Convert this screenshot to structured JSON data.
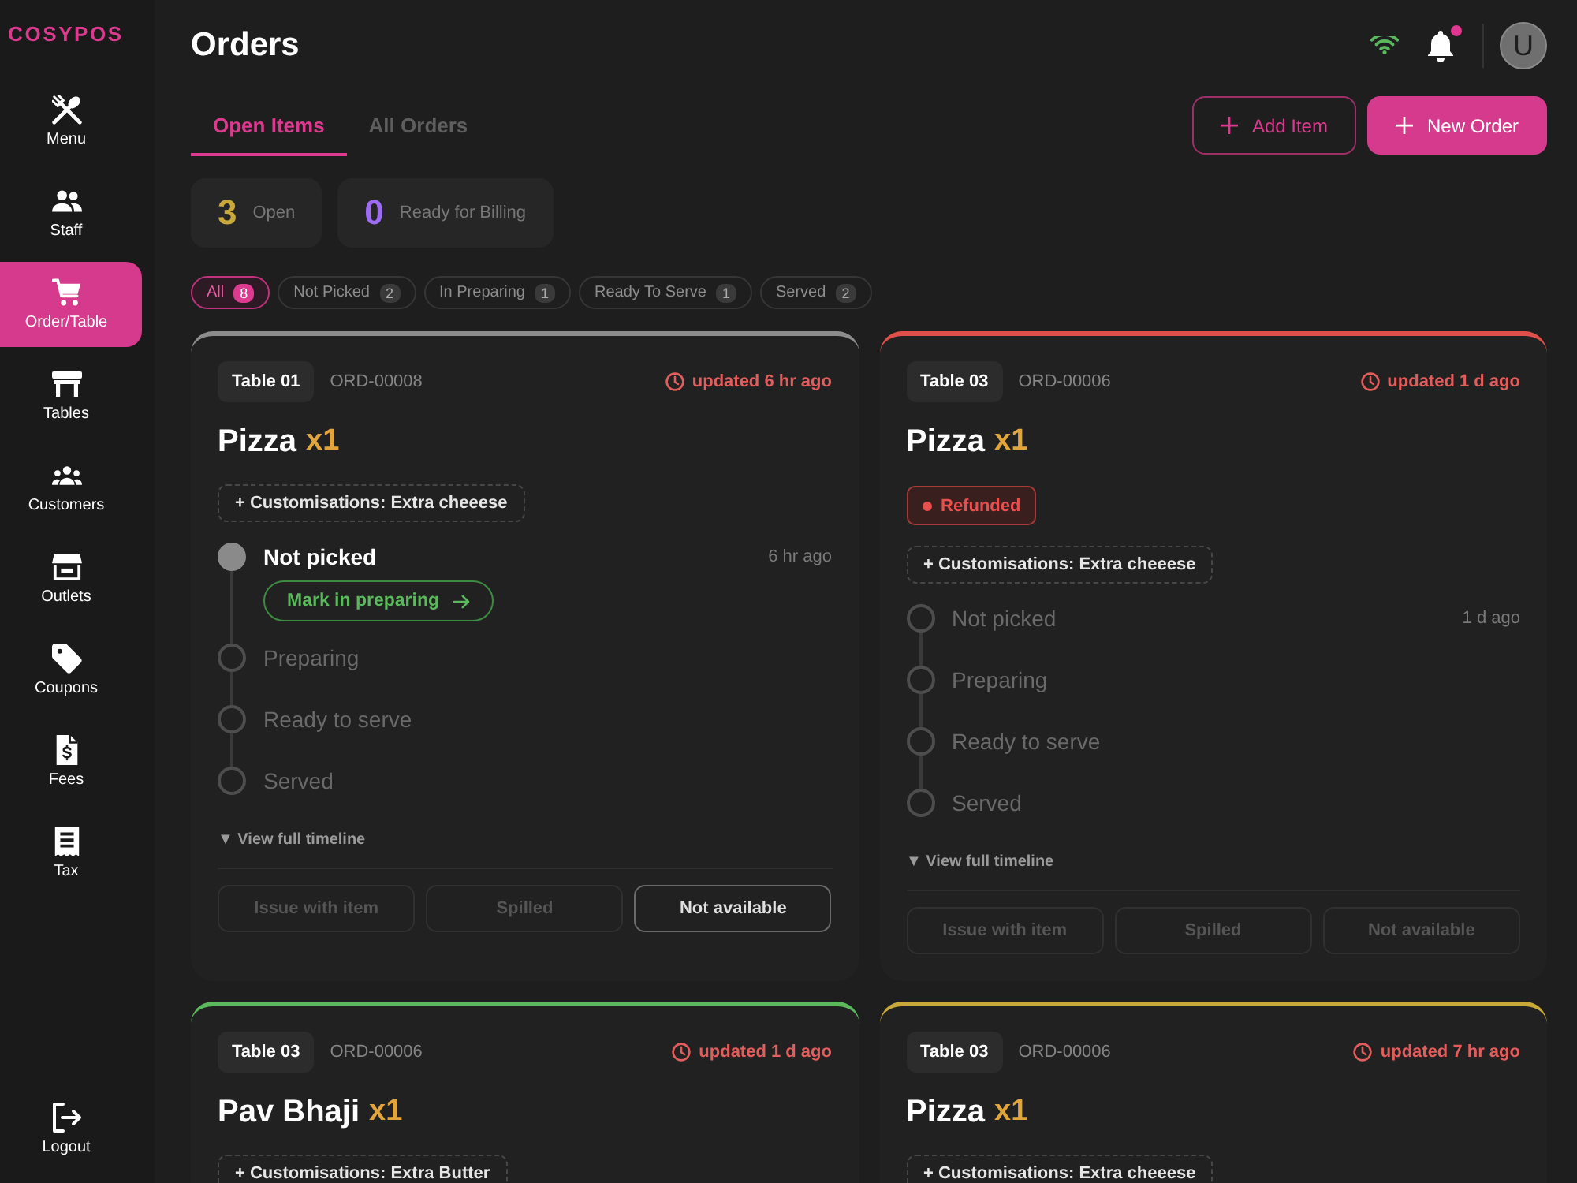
{
  "sidebar": {
    "logo": "COSYPOS",
    "items": [
      {
        "label": "Menu",
        "selected": false
      },
      {
        "label": "Staff",
        "selected": false
      },
      {
        "label": "Order/Table",
        "selected": true
      },
      {
        "label": "Tables",
        "selected": false
      },
      {
        "label": "Customers",
        "selected": false
      },
      {
        "label": "Outlets",
        "selected": false
      },
      {
        "label": "Coupons",
        "selected": false
      },
      {
        "label": "Fees",
        "selected": false
      },
      {
        "label": "Tax",
        "selected": false
      }
    ],
    "logout": "Logout"
  },
  "header": {
    "title": "Orders",
    "unread": true,
    "avatar": "U"
  },
  "tabs": [
    {
      "label": "Open Items",
      "selected": true
    },
    {
      "label": "All Orders",
      "selected": false
    }
  ],
  "actions": [
    {
      "label": "Add Item",
      "kind": "outline"
    },
    {
      "label": "New Order",
      "kind": "filled"
    }
  ],
  "stats": [
    {
      "value": "3",
      "label": "Open",
      "color": "#c9a93b"
    },
    {
      "value": "0",
      "label": "Ready for Billing",
      "color": "#9d6cf2"
    }
  ],
  "filters": [
    {
      "label": "All",
      "count": "8",
      "selected": true
    },
    {
      "label": "Not Picked",
      "count": "2",
      "selected": false
    },
    {
      "label": "In Preparing",
      "count": "1",
      "selected": false
    },
    {
      "label": "Ready To Serve",
      "count": "1",
      "selected": false
    },
    {
      "label": "Served",
      "count": "2",
      "selected": false
    }
  ],
  "orders": [
    {
      "table": "Table 01",
      "id": "ORD-00008",
      "updated": "updated 6 hr ago",
      "color": "#8c8c8c",
      "item": "Pizza",
      "qty": "x1",
      "customisation": "+ Customisations: Extra cheeese",
      "steps": [
        {
          "label": "Not picked",
          "time": "6 hr ago",
          "active": true,
          "action": "Mark in preparing"
        },
        {
          "label": "Preparing",
          "active": false
        },
        {
          "label": "Ready to serve",
          "active": false
        },
        {
          "label": "Served",
          "active": false
        }
      ],
      "timeline_link": "▼ View full timeline",
      "buttons": [
        {
          "label": "Issue with item",
          "disabled": true
        },
        {
          "label": "Spilled",
          "disabled": true
        },
        {
          "label": "Not available",
          "disabled": false
        }
      ]
    },
    {
      "table": "Table 03",
      "id": "ORD-00006",
      "updated": "updated 1 d ago",
      "color": "#e0504a",
      "item": "Pizza",
      "qty": "x1",
      "badge": "Refunded",
      "customisation": "+ Customisations: Extra cheeese",
      "steps": [
        {
          "label": "Not picked",
          "time": "1 d ago",
          "active": false
        },
        {
          "label": "Preparing",
          "active": false
        },
        {
          "label": "Ready to serve",
          "active": false
        },
        {
          "label": "Served",
          "active": false
        }
      ],
      "timeline_link": "▼ View full timeline",
      "buttons": [
        {
          "label": "Issue with item",
          "disabled": true
        },
        {
          "label": "Spilled",
          "disabled": true
        },
        {
          "label": "Not available",
          "disabled": true
        }
      ]
    },
    {
      "table": "Table 03",
      "id": "ORD-00006",
      "updated": "updated 1 d ago",
      "color": "#5cb85c",
      "item": "Pav Bhaji",
      "qty": "x1",
      "customisation": "+ Customisations: Extra Butter"
    },
    {
      "table": "Table 03",
      "id": "ORD-00006",
      "updated": "updated 7 hr ago",
      "color": "#c9a83a",
      "item": "Pizza",
      "qty": "x1",
      "customisation": "+ Customisations: Extra cheeese"
    }
  ]
}
